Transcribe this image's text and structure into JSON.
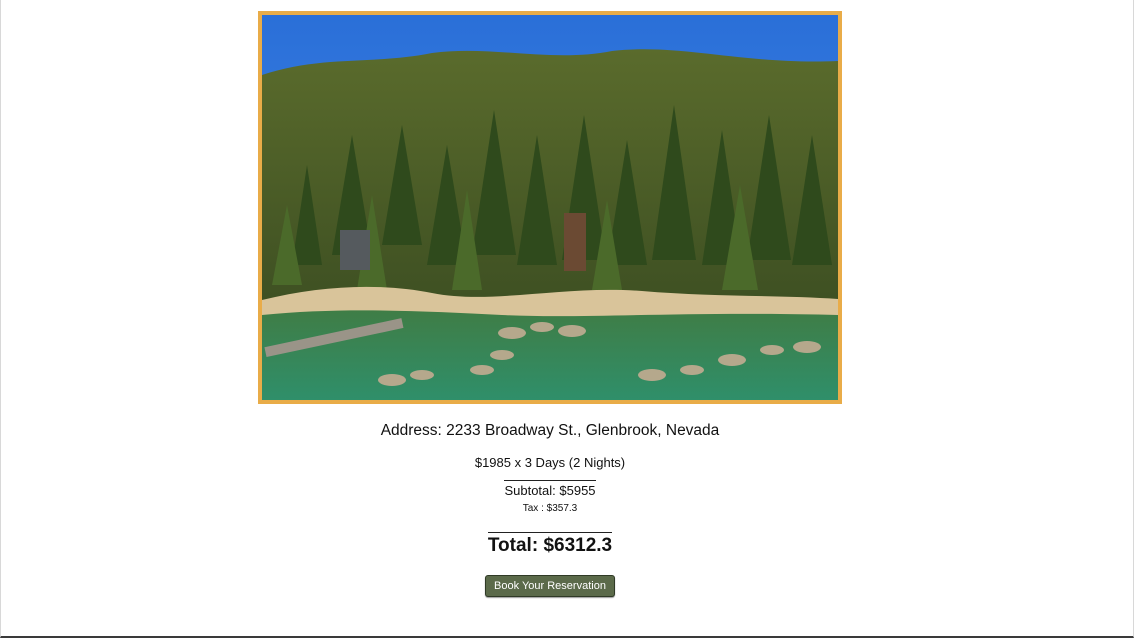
{
  "listing": {
    "address": "Address: 2233 Broadway St., Glenbrook, Nevada",
    "image_alt": "Aerial view of lakeside homes among pine forest with rocky cove"
  },
  "pricing": {
    "rate_line": "$1985 x 3 Days (2 Nights)",
    "subtotal": "Subtotal: $5955",
    "tax": "Tax : $357.3",
    "total": "Total: $6312.3"
  },
  "actions": {
    "book_label": "Book Your Reservation"
  },
  "colors": {
    "frame": "#e9ac48",
    "button": "#5b6a4a"
  }
}
